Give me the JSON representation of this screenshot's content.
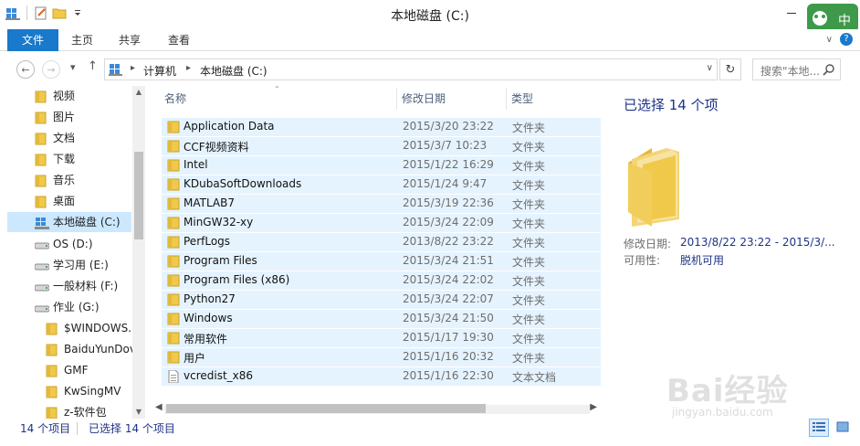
{
  "window": {
    "title": "本地磁盘 (C:)"
  },
  "ime": {
    "label": "中"
  },
  "ribbon": {
    "tabs": [
      "文件",
      "主页",
      "共享",
      "查看"
    ]
  },
  "address": {
    "segments": [
      "计算机",
      "本地磁盘 (C:)"
    ],
    "search_placeholder": "搜索\"本地..."
  },
  "nav": {
    "items": [
      {
        "label": "视频",
        "icon": "videos-folder-icon"
      },
      {
        "label": "图片",
        "icon": "pictures-folder-icon"
      },
      {
        "label": "文档",
        "icon": "documents-folder-icon"
      },
      {
        "label": "下载",
        "icon": "downloads-folder-icon"
      },
      {
        "label": "音乐",
        "icon": "music-folder-icon"
      },
      {
        "label": "桌面",
        "icon": "desktop-folder-icon"
      },
      {
        "label": "本地磁盘 (C:)",
        "icon": "system-drive-icon",
        "selected": true
      },
      {
        "label": "OS (D:)",
        "icon": "drive-icon"
      },
      {
        "label": "学习用 (E:)",
        "icon": "drive-icon"
      },
      {
        "label": "一般材料 (F:)",
        "icon": "drive-icon"
      },
      {
        "label": "作业 (G:)",
        "icon": "drive-icon"
      },
      {
        "label": "$WINDOWS.",
        "icon": "folder-icon"
      },
      {
        "label": "BaiduYunDov",
        "icon": "folder-icon"
      },
      {
        "label": "GMF",
        "icon": "folder-icon"
      },
      {
        "label": "KwSingMV",
        "icon": "folder-icon"
      },
      {
        "label": "z-软件包",
        "icon": "folder-icon"
      }
    ]
  },
  "columns": {
    "name": "名称",
    "date": "修改日期",
    "type": "类型"
  },
  "files": [
    {
      "name": "Application Data",
      "date": "2015/3/20 23:22",
      "type": "文件夹",
      "icon": "folder-icon"
    },
    {
      "name": "CCF视频资料",
      "date": "2015/3/7 10:23",
      "type": "文件夹",
      "icon": "folder-icon"
    },
    {
      "name": "Intel",
      "date": "2015/1/22 16:29",
      "type": "文件夹",
      "icon": "folder-icon"
    },
    {
      "name": "KDubaSoftDownloads",
      "date": "2015/1/24 9:47",
      "type": "文件夹",
      "icon": "folder-icon"
    },
    {
      "name": "MATLAB7",
      "date": "2015/3/19 22:36",
      "type": "文件夹",
      "icon": "folder-icon"
    },
    {
      "name": "MinGW32-xy",
      "date": "2015/3/24 22:09",
      "type": "文件夹",
      "icon": "folder-icon"
    },
    {
      "name": "PerfLogs",
      "date": "2013/8/22 23:22",
      "type": "文件夹",
      "icon": "folder-icon"
    },
    {
      "name": "Program Files",
      "date": "2015/3/24 21:51",
      "type": "文件夹",
      "icon": "folder-icon"
    },
    {
      "name": "Program Files (x86)",
      "date": "2015/3/24 22:02",
      "type": "文件夹",
      "icon": "folder-icon"
    },
    {
      "name": "Python27",
      "date": "2015/3/24 22:07",
      "type": "文件夹",
      "icon": "folder-icon"
    },
    {
      "name": "Windows",
      "date": "2015/3/24 21:50",
      "type": "文件夹",
      "icon": "folder-icon"
    },
    {
      "name": "常用软件",
      "date": "2015/1/17 19:30",
      "type": "文件夹",
      "icon": "folder-icon"
    },
    {
      "name": "用户",
      "date": "2015/1/16 20:32",
      "type": "文件夹",
      "icon": "folder-icon"
    },
    {
      "name": "vcredist_x86",
      "date": "2015/1/16 22:30",
      "type": "文本文档",
      "icon": "text-document-icon"
    }
  ],
  "details": {
    "title": "已选择 14 个项",
    "modified_label": "修改日期:",
    "modified_value": "2013/8/22 23:22 - 2015/3/...",
    "availability_label": "可用性:",
    "availability_value": "脱机可用"
  },
  "status": {
    "count": "14 个项目",
    "selected": "已选择 14 个项目"
  },
  "watermark": {
    "brand": "Bai经验",
    "url": "jingyan.baidu.com"
  },
  "colors": {
    "accent": "#1979ca",
    "selection": "#cce8ff",
    "hover": "#e5f3ff",
    "folder": "#f0c94a",
    "link": "#1e3287"
  }
}
